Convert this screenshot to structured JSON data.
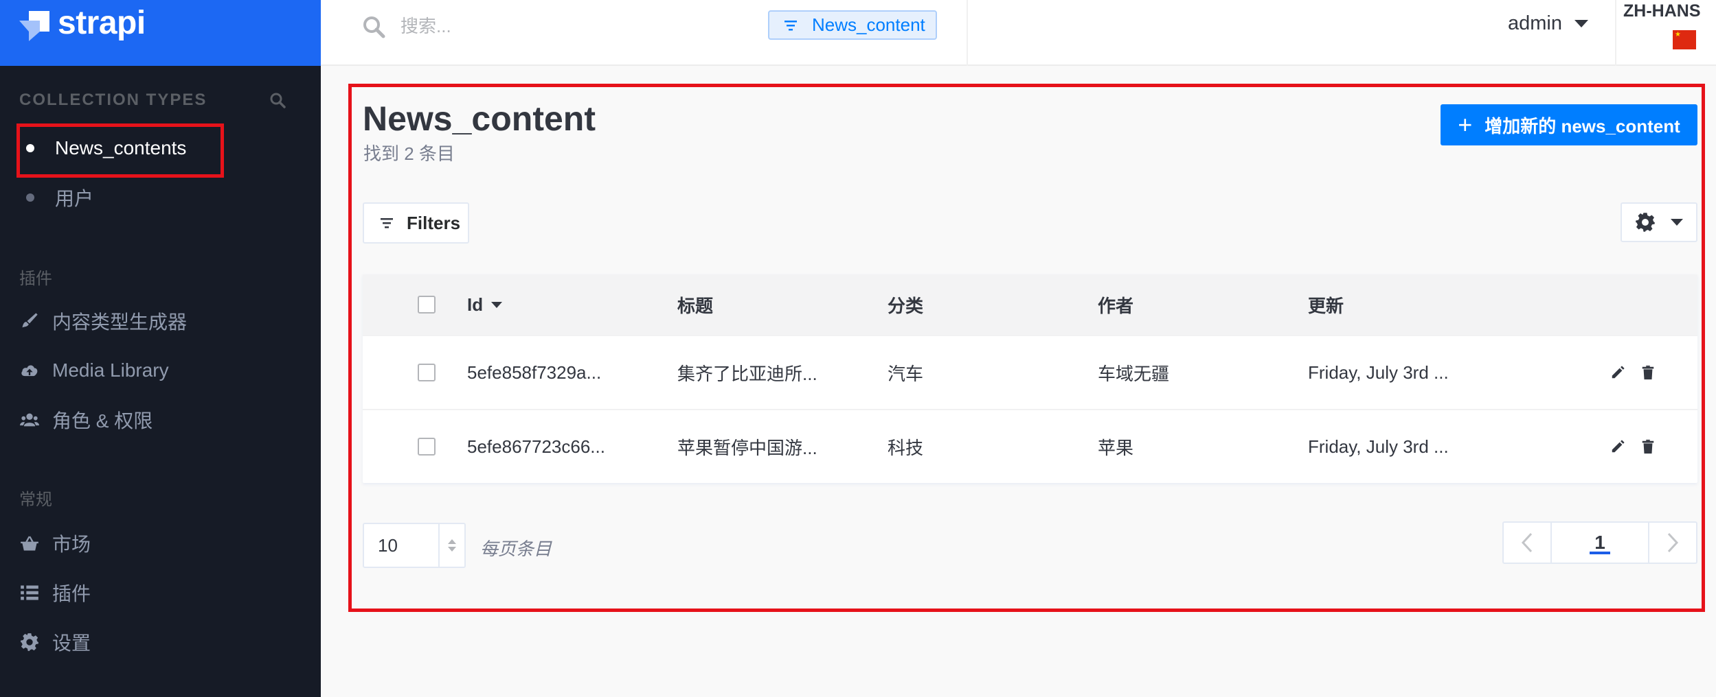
{
  "brand": {
    "name": "strapi"
  },
  "sidebar": {
    "collection_heading": "COLLECTION TYPES",
    "collection_items": [
      {
        "label": "News_contents",
        "active": true
      },
      {
        "label": "用户",
        "active": false
      }
    ],
    "plugins_heading": "插件",
    "plugin_items": [
      {
        "label": "内容类型生成器",
        "icon": "brush-icon"
      },
      {
        "label": "Media Library",
        "icon": "cloud-upload-icon"
      },
      {
        "label": "角色 & 权限",
        "icon": "users-icon"
      }
    ],
    "general_heading": "常规",
    "general_items": [
      {
        "label": "市场",
        "icon": "basket-icon"
      },
      {
        "label": "插件",
        "icon": "list-icon"
      },
      {
        "label": "设置",
        "icon": "gear-icon"
      }
    ]
  },
  "header": {
    "search_placeholder": "搜索...",
    "filter_chip": "News_content",
    "user": "admin",
    "language": "ZH-HANS"
  },
  "main": {
    "title": "News_content",
    "subtitle": "找到 2 条目",
    "add_button": "增加新的 news_content",
    "filters_label": "Filters",
    "table": {
      "columns": [
        "Id",
        "标题",
        "分类",
        "作者",
        "更新"
      ],
      "rows": [
        {
          "id": "5efe858f7329a...",
          "title": "集齐了比亚迪所...",
          "category": "汽车",
          "author": "车域无疆",
          "updated": "Friday, July 3rd ..."
        },
        {
          "id": "5efe867723c66...",
          "title": "苹果暂停中国游...",
          "category": "科技",
          "author": "苹果",
          "updated": "Friday, July 3rd ..."
        }
      ]
    },
    "per_page_value": "10",
    "per_page_label": "每页条目",
    "current_page": "1"
  },
  "colors": {
    "brand_blue": "#1c68f3",
    "sidebar_bg": "#161b26",
    "primary": "#007eff",
    "highlight": "#e6121a"
  }
}
